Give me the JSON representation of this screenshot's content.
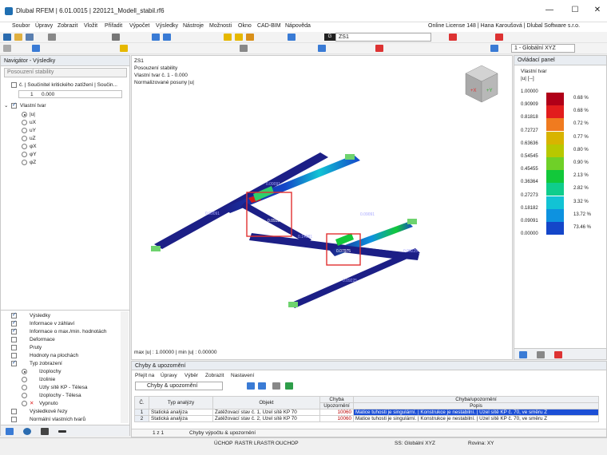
{
  "title": "Dlubal RFEM | 6.01.0015 | 220121_Modell_stabil.rf6",
  "window_buttons": [
    "—",
    "☐",
    "✕"
  ],
  "menu": [
    "Soubor",
    "Úpravy",
    "Zobrazit",
    "Vložit",
    "Přiřadit",
    "Výpočet",
    "Výsledky",
    "Nástroje",
    "Možnosti",
    "Okno",
    "CAD-BIM",
    "Nápověda"
  ],
  "license": "Online License 148 | Hana Karoušová | Dlubal Software s.r.o.",
  "toolbar": {
    "g_badge": "G",
    "loadcase": "ZS1",
    "coord_system": "1 - Globální XYZ"
  },
  "navigator": {
    "title": "Navigátor - Výsledky",
    "dropdown": "Posouzení stability",
    "factor_label": "č. | Součinitel kritického zatížení | Součin...",
    "factor_no": "1",
    "factor_val": "0.000",
    "mode_shape": "Vlastní tvar",
    "options": [
      "|u|",
      "uX",
      "uY",
      "uZ",
      "φX",
      "φY",
      "φZ"
    ],
    "lower": [
      "Výsledky",
      "Informace v záhlaví",
      "Informace o max./min. hodnotách",
      "Deformace",
      "Pruty",
      "Hodnoty na plochách",
      "Typ zobrazení",
      "Izoplochy",
      "Izolinie",
      "Uzly sítě KP - Tělesa",
      "Izoplochy - Tělesa",
      "Vypnuto",
      "Výsledkové řezy",
      "Normální vlastních tvarů"
    ]
  },
  "viewport": {
    "info": [
      "ZS1",
      "Posouzení stability",
      "Vlastní tvar č. 1 - 0.000",
      "Normalizované posuny |u|"
    ],
    "max_min": "max |u| : 1.00000 | min |u| : 0.00000",
    "member_labels": [
      "0.09091",
      "0.09091",
      "0.14981",
      "0.09091",
      "0.09225",
      "0.09225",
      "0.07975",
      "0.09324"
    ]
  },
  "control_panel": {
    "title": "Ovládací panel",
    "subtitle": "Vlastní tvar",
    "unit": "|u| [--]",
    "scale": [
      {
        "value": "1.00000",
        "pct": "0.68 %",
        "color": "#b00018"
      },
      {
        "value": "0.90909",
        "pct": "0.68 %",
        "color": "#e21d1d"
      },
      {
        "value": "0.81818",
        "pct": "0.72 %",
        "color": "#f07b1f"
      },
      {
        "value": "0.72727",
        "pct": "0.77 %",
        "color": "#d8b400"
      },
      {
        "value": "0.63636",
        "pct": "0.80 %",
        "color": "#b8c800"
      },
      {
        "value": "0.54545",
        "pct": "0.90 %",
        "color": "#6fd028"
      },
      {
        "value": "0.45455",
        "pct": "2.13 %",
        "color": "#12c83a"
      },
      {
        "value": "0.36364",
        "pct": "2.82 %",
        "color": "#0fcd8c"
      },
      {
        "value": "0.27273",
        "pct": "3.32 %",
        "color": "#12c3d4"
      },
      {
        "value": "0.18182",
        "pct": "13.72 %",
        "color": "#0d92e0"
      },
      {
        "value": "0.09091",
        "pct": "73.46 %",
        "color": "#1446c9"
      },
      {
        "value": "0.00000",
        "pct": "",
        "color": "#1c1f86"
      }
    ]
  },
  "errors_panel": {
    "title": "Chyby & upozornění",
    "menu": [
      "Přejít na",
      "Úpravy",
      "Výběr",
      "Zobrazit",
      "Nastavení"
    ],
    "dropdown": "Chyby & upozornění",
    "headers": {
      "no": "Č.",
      "type": "Typ analýzy",
      "object": "Objekt",
      "code_top": "Chyba",
      "code": "Upozornění",
      "desc_top": "Chyba/upozornění",
      "desc": "Popis"
    },
    "rows": [
      {
        "no": "1",
        "type": "Statická analýza",
        "object": "Zatěžovací stav č. 1, Uzel sítě KP 70",
        "code": "10060",
        "desc": "Matice tuhosti je singulární. | Konstrukce je nestabilní. | Uzel sítě KP č. 70, ve směru Z"
      },
      {
        "no": "2",
        "type": "Statická analýza",
        "object": "Zatěžovací stav č. 2, Uzel sítě KP 70",
        "code": "10060",
        "desc": "Matice tuhosti je singulární. | Konstrukce je nestabilní. | Uzel sítě KP č. 70, ve směru Z"
      }
    ],
    "pager": "1 z 1",
    "tab": "Chyby výpočtu & upozornění"
  },
  "status": {
    "snap": [
      "ÚCHOP",
      "RASTR",
      "LRASTR",
      "OUCHOP"
    ],
    "cs": "SS: Globální XYZ",
    "plane": "Rovina: XY"
  }
}
